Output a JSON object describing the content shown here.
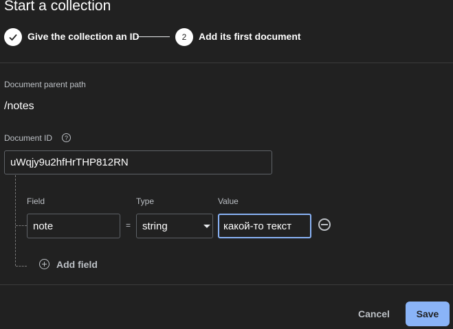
{
  "dialog": {
    "title": "Start a collection"
  },
  "stepper": {
    "step1": {
      "label": "Give the collection an ID",
      "icon": "check-icon"
    },
    "step2": {
      "number": "2",
      "label": "Add its first document"
    }
  },
  "parent_path": {
    "label": "Document parent path",
    "value": "/notes"
  },
  "document_id": {
    "label": "Document ID",
    "help_icon": "help-icon",
    "value": "uWqjy9u2hfHrTHP812RN"
  },
  "fields": {
    "headers": {
      "field": "Field",
      "type": "Type",
      "value": "Value"
    },
    "rows": [
      {
        "field": "note",
        "equals": "=",
        "type": "string",
        "value": "какой-то текст"
      }
    ],
    "add_label": "Add field"
  },
  "actions": {
    "cancel": "Cancel",
    "save": "Save"
  },
  "colors": {
    "accent": "#8ab4f8",
    "background": "#212121",
    "border": "#5f6368"
  }
}
